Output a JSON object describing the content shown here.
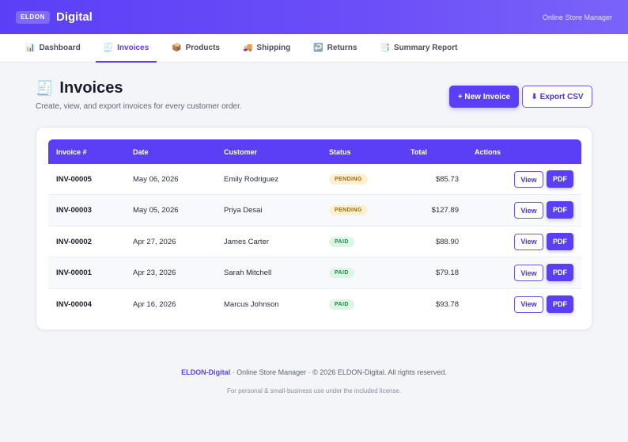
{
  "header": {
    "logo_badge": "ELDON",
    "brand": "Digital",
    "right_text": "Online Store Manager"
  },
  "nav": {
    "items": [
      {
        "icon": "📊",
        "icon_name": "bar-chart-icon",
        "label": "Dashboard",
        "active": false
      },
      {
        "icon": "🧾",
        "icon_name": "receipt-icon",
        "label": "Invoices",
        "active": true
      },
      {
        "icon": "📦",
        "icon_name": "package-icon",
        "label": "Products",
        "active": false
      },
      {
        "icon": "🚚",
        "icon_name": "truck-icon",
        "label": "Shipping",
        "active": false
      },
      {
        "icon": "↩️",
        "icon_name": "return-arrow-icon",
        "label": "Returns",
        "active": false
      },
      {
        "icon": "📑",
        "icon_name": "report-icon",
        "label": "Summary Report",
        "active": false
      }
    ]
  },
  "page": {
    "title_icon": "🧾",
    "title": "Invoices",
    "subtitle": "Create, view, and export invoices for every customer order.",
    "new_invoice_label": "+ New Invoice",
    "export_csv_label": "⬇ Export CSV"
  },
  "table": {
    "columns": [
      "Invoice #",
      "Date",
      "Customer",
      "Status",
      "Total",
      "Actions"
    ],
    "rows": [
      {
        "invoice": "INV-00005",
        "date": "May 06, 2026",
        "customer": "Emily Rodriguez",
        "status": "PENDING",
        "total": "$85.73"
      },
      {
        "invoice": "INV-00003",
        "date": "May 05, 2026",
        "customer": "Priya Desai",
        "status": "PENDING",
        "total": "$127.89"
      },
      {
        "invoice": "INV-00002",
        "date": "Apr 27, 2026",
        "customer": "James Carter",
        "status": "PAID",
        "total": "$88.90"
      },
      {
        "invoice": "INV-00001",
        "date": "Apr 23, 2026",
        "customer": "Sarah Mitchell",
        "status": "PAID",
        "total": "$79.18"
      },
      {
        "invoice": "INV-00004",
        "date": "Apr 16, 2026",
        "customer": "Marcus Johnson",
        "status": "PAID",
        "total": "$93.78"
      }
    ],
    "view_label": "View",
    "pdf_label": "PDF"
  },
  "footer": {
    "brand": "ELDON-Digital",
    "line1_rest": " · Online Store Manager · © 2026 ELDON-Digital. All rights reserved.",
    "line2": "For personal & small-business use under the included license."
  },
  "colors": {
    "accent": "#5b3ff6",
    "pending_bg": "#fdf0cf",
    "paid_bg": "#dcf5e5"
  }
}
